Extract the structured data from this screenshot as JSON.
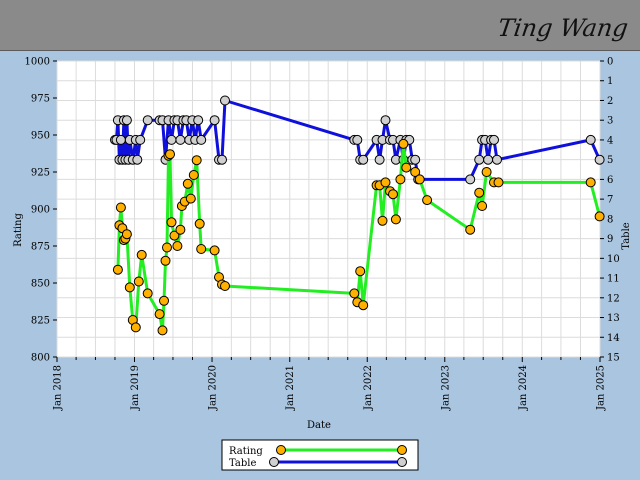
{
  "header": {
    "signature": "Ting Wang"
  },
  "chart_data": {
    "type": "line",
    "xlabel": "Date",
    "ylabel_left": "Rating",
    "ylabel_right": "Table",
    "x_ticks": [
      "Jan 2018",
      "Jan 2019",
      "Jan 2020",
      "Jan 2021",
      "Jan 2022",
      "Jan 2023",
      "Jan 2024",
      "Jan 2025"
    ],
    "xlim": [
      "2018-01-01",
      "2025-01-01"
    ],
    "ylim_left": [
      800,
      1000
    ],
    "y_ticks_left": [
      800,
      825,
      850,
      875,
      900,
      925,
      950,
      975,
      1000
    ],
    "ylim_right": [
      0,
      15
    ],
    "y_ticks_right": [
      0,
      1,
      2,
      3,
      4,
      5,
      6,
      7,
      8,
      9,
      10,
      11,
      12,
      13,
      14,
      15
    ],
    "grid": true,
    "legend_position": "bottom-center",
    "series": [
      {
        "name": "Rating",
        "axis": "left",
        "color": "#22ee22",
        "marker_color": "#ffb000",
        "x": [
          "2018-10-15",
          "2018-10-22",
          "2018-10-29",
          "2018-11-05",
          "2018-11-12",
          "2018-11-19",
          "2018-11-26",
          "2018-12-10",
          "2018-12-24",
          "2019-01-07",
          "2019-01-21",
          "2019-02-04",
          "2019-03-04",
          "2019-04-29",
          "2019-05-13",
          "2019-05-20",
          "2019-05-27",
          "2019-06-03",
          "2019-06-10",
          "2019-06-17",
          "2019-06-24",
          "2019-07-08",
          "2019-07-22",
          "2019-08-05",
          "2019-08-12",
          "2019-08-26",
          "2019-09-09",
          "2019-09-23",
          "2019-10-07",
          "2019-10-21",
          "2019-11-04",
          "2019-11-11",
          "2020-01-13",
          "2020-02-03",
          "2020-02-17",
          "2020-03-02",
          "2021-11-01",
          "2021-11-15",
          "2021-11-29",
          "2021-12-13",
          "2022-02-14",
          "2022-02-28",
          "2022-03-14",
          "2022-03-28",
          "2022-04-18",
          "2022-05-02",
          "2022-05-16",
          "2022-06-06",
          "2022-06-20",
          "2022-07-04",
          "2022-08-15",
          "2022-09-05",
          "2022-10-10",
          "2023-05-01",
          "2023-06-12",
          "2023-06-26",
          "2023-07-17",
          "2023-08-21",
          "2023-09-11",
          "2024-11-18",
          "2024-12-30"
        ],
        "values": [
          859,
          889,
          901,
          887,
          879,
          880,
          883,
          847,
          825,
          820,
          851,
          869,
          843,
          829,
          818,
          838,
          865,
          874,
          936,
          937,
          891,
          882,
          875,
          886,
          902,
          905,
          917,
          907,
          923,
          933,
          890,
          873,
          872,
          854,
          849,
          848,
          843,
          837,
          858,
          835,
          916,
          916,
          892,
          918,
          912,
          910,
          893,
          920,
          944,
          928,
          925,
          920,
          906,
          886,
          911,
          902,
          925,
          918,
          918,
          918,
          895
        ]
      },
      {
        "name": "Table",
        "axis": "right",
        "color": "#1010dd",
        "marker_color": "#d0d0d0",
        "x": [
          "2018-10-01",
          "2018-10-08",
          "2018-10-15",
          "2018-10-22",
          "2018-10-29",
          "2018-11-05",
          "2018-11-12",
          "2018-11-19",
          "2018-11-26",
          "2018-12-03",
          "2018-12-10",
          "2018-12-24",
          "2019-01-07",
          "2019-01-14",
          "2019-01-28",
          "2019-03-04",
          "2019-04-29",
          "2019-05-13",
          "2019-05-27",
          "2019-06-10",
          "2019-06-24",
          "2019-07-08",
          "2019-07-22",
          "2019-08-05",
          "2019-08-19",
          "2019-09-02",
          "2019-09-16",
          "2019-09-30",
          "2019-10-14",
          "2019-10-28",
          "2019-11-11",
          "2020-01-13",
          "2020-02-03",
          "2020-02-17",
          "2020-03-02",
          "2021-11-01",
          "2021-11-15",
          "2021-11-29",
          "2021-12-13",
          "2022-02-14",
          "2022-02-28",
          "2022-03-14",
          "2022-03-28",
          "2022-04-18",
          "2022-05-02",
          "2022-05-16",
          "2022-06-06",
          "2022-06-20",
          "2022-07-04",
          "2022-07-18",
          "2022-08-01",
          "2022-08-15",
          "2022-08-29",
          "2023-05-01",
          "2023-06-12",
          "2023-06-26",
          "2023-07-10",
          "2023-07-24",
          "2023-08-07",
          "2023-08-21",
          "2023-09-04",
          "2024-11-18",
          "2024-12-30"
        ],
        "values": [
          4,
          4,
          3,
          5,
          4,
          5,
          3,
          5,
          3,
          5,
          4,
          5,
          4,
          5,
          4,
          3,
          3,
          3,
          5,
          3,
          4,
          3,
          3,
          4,
          3,
          3,
          4,
          3,
          4,
          3,
          4,
          3,
          5,
          5,
          2,
          4,
          4,
          5,
          5,
          4,
          5,
          4,
          3,
          4,
          4,
          5,
          4,
          5,
          4,
          4,
          5,
          5,
          6,
          6,
          5,
          4,
          4,
          5,
          4,
          4,
          5,
          4,
          5
        ]
      }
    ]
  }
}
